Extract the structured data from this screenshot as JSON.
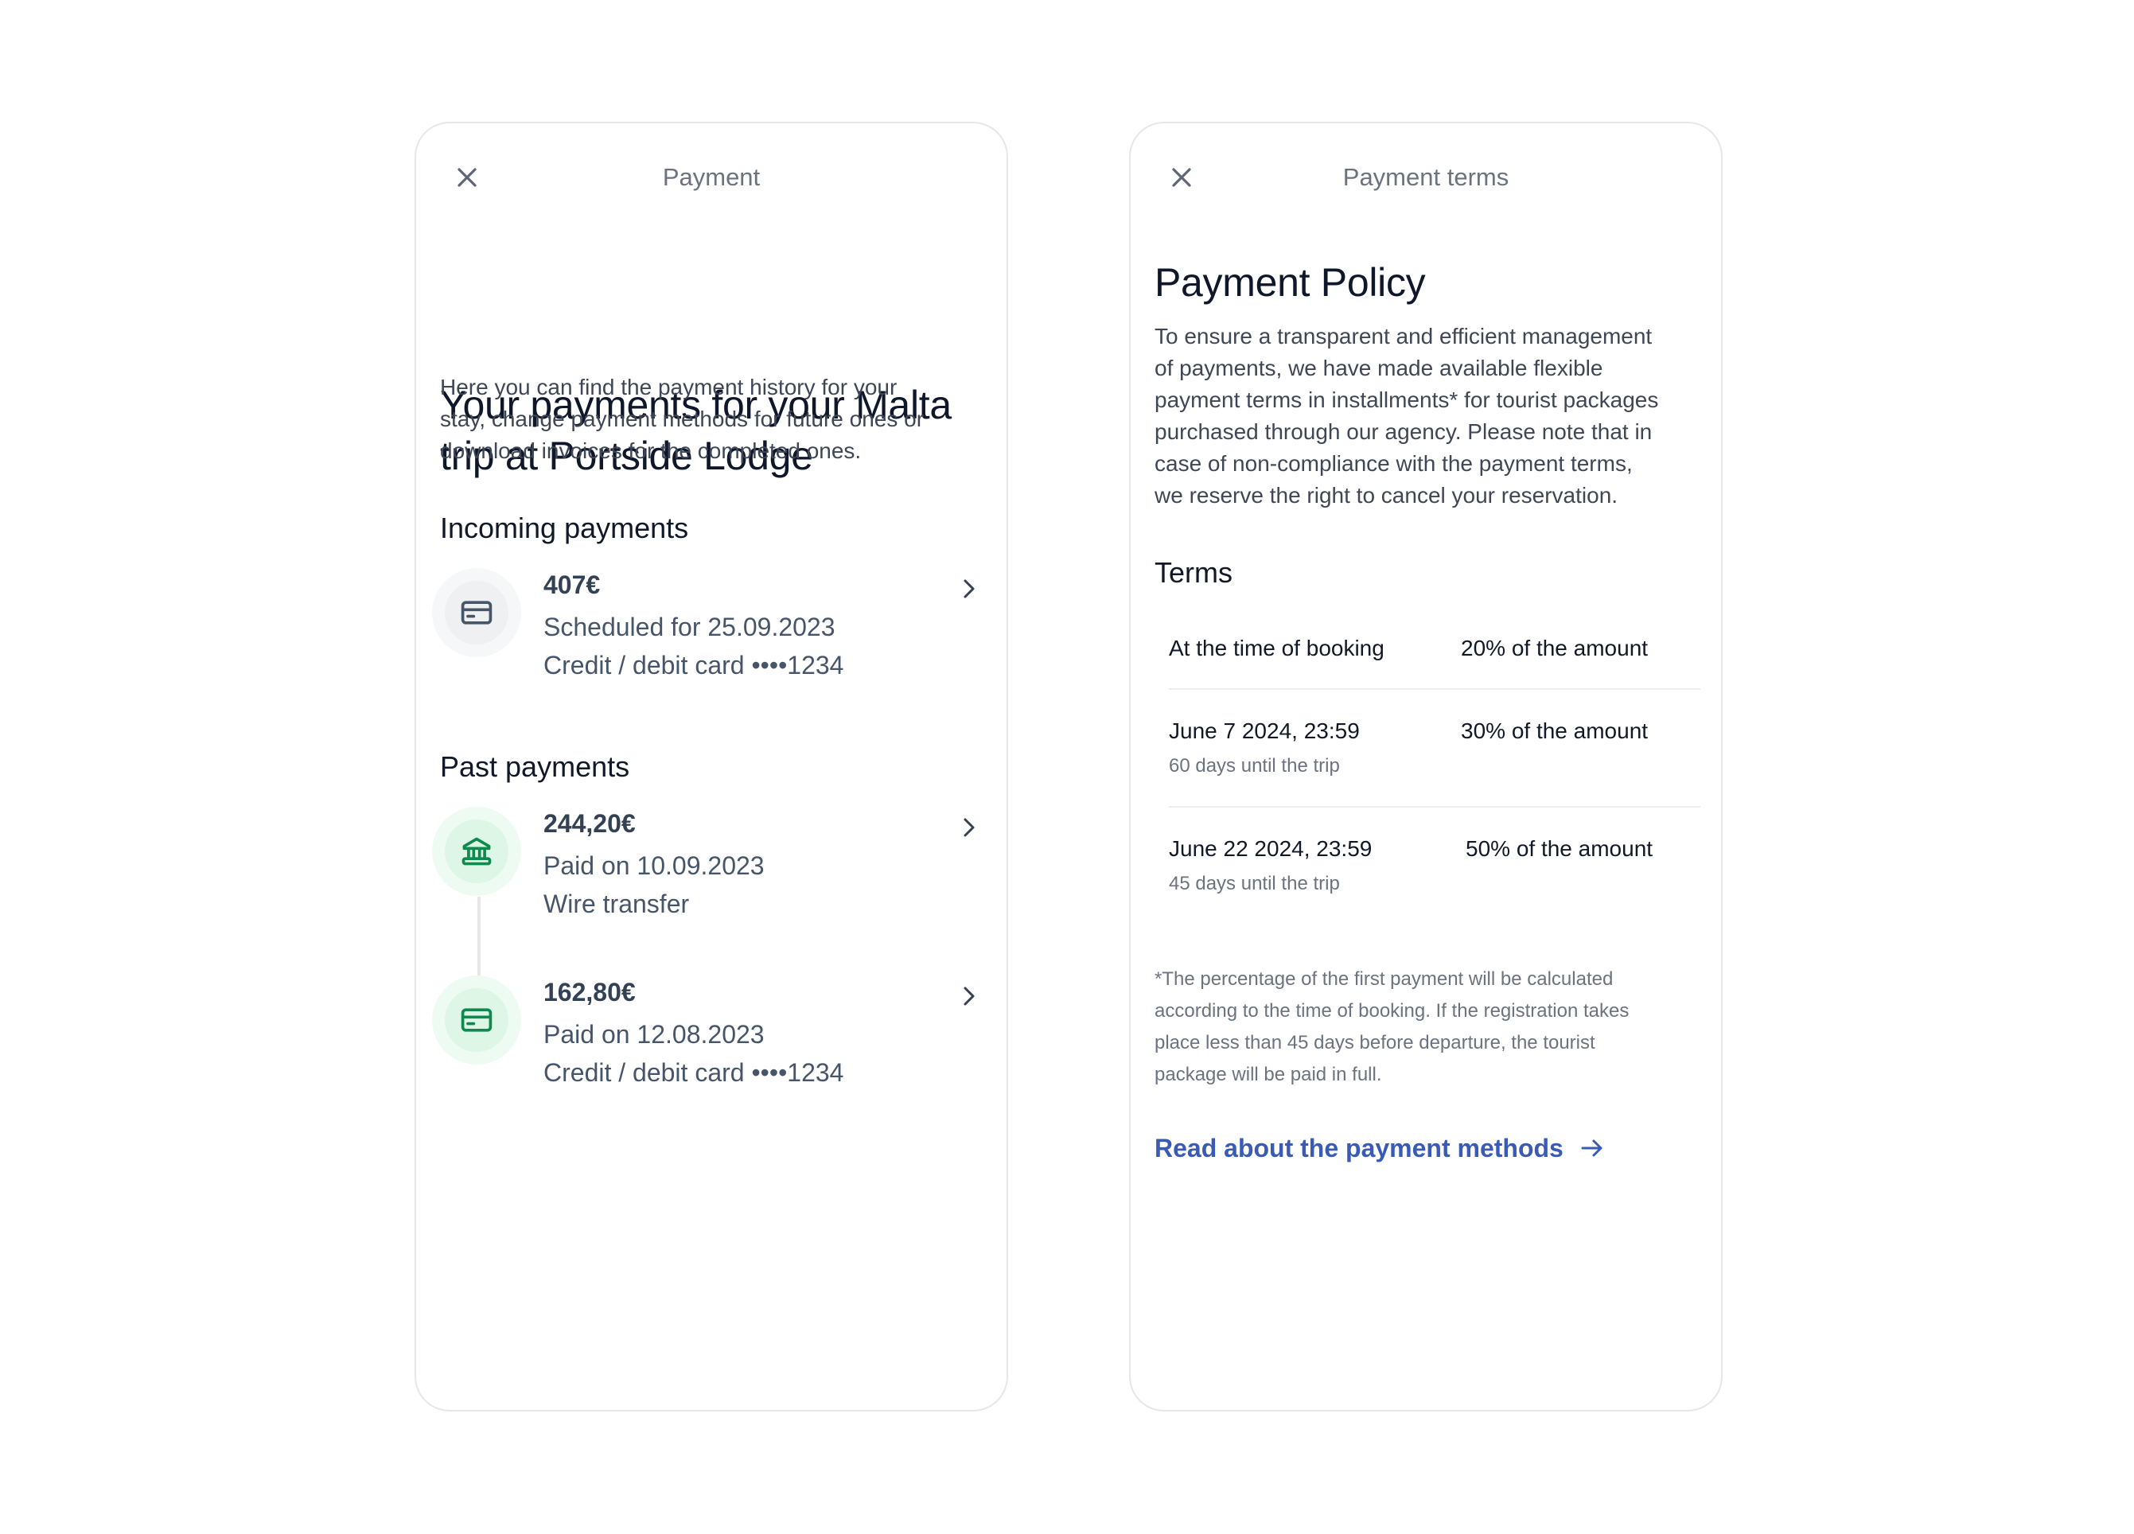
{
  "colors": {
    "accent_link": "#3A5BB5",
    "success_green": "#0E8A4F",
    "neutral_icon": "#475569",
    "border": "#E6E7EA"
  },
  "payment_screen": {
    "topbar": {
      "title": "Payment",
      "close_icon": "close-icon"
    },
    "heading_line1": "Your payments for your Malta",
    "heading_line2": "trip at Portside Lodge",
    "description_lines": [
      "Here you can find the payment history for your",
      "stay, change payment methods for future ones or",
      "download invoices for the completed ones."
    ],
    "incoming": {
      "title": "Incoming payments",
      "items": [
        {
          "icon": "credit-card-icon",
          "amount": "407€",
          "line1": "Scheduled for 25.09.2023",
          "line2": "Credit / debit card ••••1234",
          "status": "scheduled"
        }
      ]
    },
    "past": {
      "title": "Past payments",
      "items": [
        {
          "icon": "bank-icon",
          "amount": "244,20€",
          "line1": "Paid on 10.09.2023",
          "line2": "Wire transfer",
          "status": "paid"
        },
        {
          "icon": "credit-card-icon",
          "amount": "162,80€",
          "line1": "Paid on 12.08.2023",
          "line2": "Credit / debit card ••••1234",
          "status": "paid"
        }
      ]
    }
  },
  "terms_screen": {
    "topbar": {
      "title": "Payment terms",
      "close_icon": "close-icon"
    },
    "heading": "Payment Policy",
    "paragraph_lines": [
      "To ensure a transparent and efficient management",
      "of payments, we have made available flexible",
      "payment terms in installments* for tourist packages",
      "purchased through our agency. Please note that in",
      "case of non-compliance with the payment terms,",
      "we reserve the right to cancel your reservation."
    ],
    "terms_title": "Terms",
    "terms": [
      {
        "deadline": "At the time of booking",
        "note": "",
        "share": "20% of the amount"
      },
      {
        "deadline": "June 7 2024, 23:59",
        "note": "60 days until the trip",
        "share": "30% of the amount"
      },
      {
        "deadline": "June 22 2024, 23:59",
        "note": "45 days until the trip",
        "share": "50% of the amount"
      }
    ],
    "footnote_lines": [
      "*The percentage of the first payment will be calculated",
      "according to the time of booking. If the registration takes",
      "place less than 45 days before departure, the tourist",
      "package will be paid in full."
    ],
    "link_label": "Read about the payment methods",
    "link_icon": "arrow-right-icon"
  }
}
